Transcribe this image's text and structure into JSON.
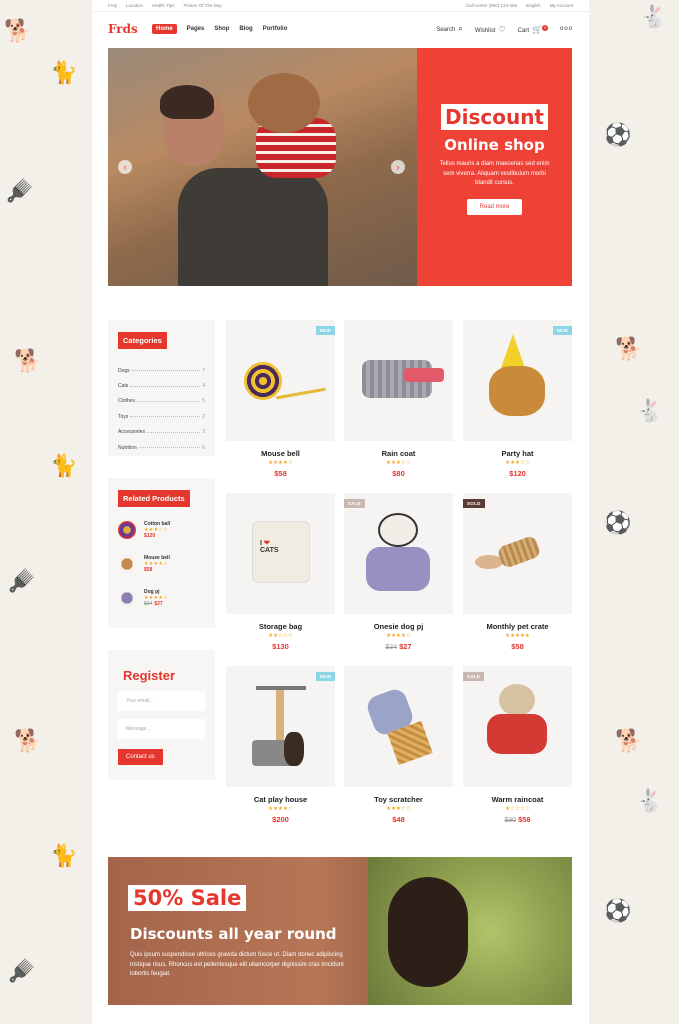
{
  "topbar": {
    "left": [
      "FAQ",
      "Location",
      "Health Tips",
      "Picture Of The Day"
    ],
    "right": [
      "Call center (800) 123-456",
      "English",
      "My Account"
    ]
  },
  "header": {
    "logo": "Frds",
    "nav": [
      "Home",
      "Pages",
      "Shop",
      "Blog",
      "Portfolio"
    ],
    "search": "Search",
    "wishlist": "Wishlist",
    "cart": "Cart",
    "cart_count": "0"
  },
  "hero": {
    "discount": "Discount",
    "online": "Online shop",
    "text": "Tellus mauris a diam maecenas sed enim sem viverra. Aliquam vestibulum morbi blandit cursus.",
    "button": "Read more"
  },
  "categories": {
    "title": "Categories",
    "items": [
      {
        "label": "Dogs",
        "count": "7"
      },
      {
        "label": "Cats",
        "count": "4"
      },
      {
        "label": "Clothes",
        "count": "5"
      },
      {
        "label": "Toys",
        "count": "2"
      },
      {
        "label": "Accessories",
        "count": "3"
      },
      {
        "label": "Nutrition",
        "count": "6"
      }
    ]
  },
  "related": {
    "title": "Related Products",
    "items": [
      {
        "name": "Cotton ball",
        "stars": "★★★☆☆",
        "price": "$120",
        "old": ""
      },
      {
        "name": "Mouse bell",
        "stars": "★★★★☆",
        "price": "$58",
        "old": ""
      },
      {
        "name": "Dog pj",
        "stars": "★★★★☆",
        "price": "$27",
        "old": "$34"
      }
    ]
  },
  "register": {
    "title": "Register",
    "email_placeholder": "Your email...",
    "message_placeholder": "Message...",
    "button": "Contact us"
  },
  "products": [
    {
      "name": "Mouse bell",
      "stars": "★★★★☆",
      "price": "$58",
      "old": "",
      "tag": "NEW"
    },
    {
      "name": "Rain coat",
      "stars": "★★★☆☆",
      "price": "$80",
      "old": "",
      "tag": ""
    },
    {
      "name": "Party hat",
      "stars": "★★★☆☆",
      "price": "$120",
      "old": "",
      "tag": "NEW"
    },
    {
      "name": "Storage bag",
      "stars": "★★☆☆☆",
      "price": "$130",
      "old": "",
      "tag": ""
    },
    {
      "name": "Onesie dog pj",
      "stars": "★★★★☆",
      "price": "$27",
      "old": "$34",
      "tag": "SALE"
    },
    {
      "name": "Monthly pet crate",
      "stars": "★★★★★",
      "price": "$58",
      "old": "",
      "tag": "SOLD"
    },
    {
      "name": "Cat play house",
      "stars": "★★★★☆",
      "price": "$200",
      "old": "",
      "tag": "NEW"
    },
    {
      "name": "Toy scratcher",
      "stars": "★★★☆☆",
      "price": "$48",
      "old": "",
      "tag": ""
    },
    {
      "name": "Warm raincoat",
      "stars": "★☆☆☆☆",
      "price": "$58",
      "old": "$90",
      "tag": "SALE"
    }
  ],
  "banner": {
    "sale": "50% Sale",
    "subtitle": "Discounts all year round",
    "text": "Quis ipsum suspendisse ultrices gravida dictum fusce ut. Diam donec adipiscing tristique risus. Rhoncus est pellentesque elit ullamcorper dignissim cras tincidunt lobortis feugiat."
  },
  "colors": {
    "accent": "#e5372e",
    "new_tag": "#8bd5e6",
    "star": "#f5a623"
  }
}
